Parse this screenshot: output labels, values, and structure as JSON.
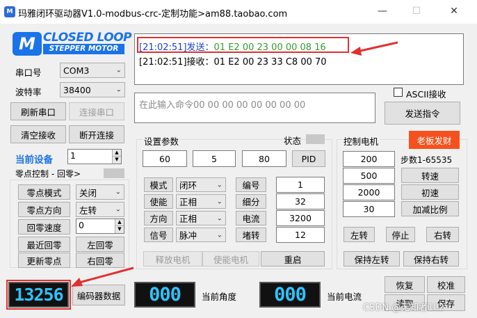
{
  "window": {
    "title": "玛雅闭环驱动器V1.0-modbus-crc-定制功能>am88.taobao.com",
    "icon_name": "app-logo-icon",
    "minimize": "—",
    "maximize": "☐",
    "close": "✕"
  },
  "logo": {
    "line1": "CLOSED LOOP",
    "line2": "STEPPER MOTOR",
    "mark": "M",
    "accent": "#1a73e8"
  },
  "serial": {
    "port_label": "串口号",
    "port_value": "COM3",
    "baud_label": "波特率",
    "baud_value": "38400",
    "refresh_btn": "刷新串口",
    "connect_btn": "连接串口",
    "clear_btn": "清空接收",
    "disconnect_btn": "断开连接"
  },
  "rx": {
    "line1_time": "[21:02:51]",
    "line1_kind": "发送：",
    "line1_data": "01 E2 00 23 00 00 08 16",
    "line2": "[21:02:51]接收：01 E2 00 23 33 C8 00 70",
    "ascii_label": "ASCII接收",
    "send_color": "#2e9e2e",
    "highlight_color": "#e03131"
  },
  "cmd": {
    "placeholder": "在此输入命令00 00 00 00 00 00 00 00",
    "send_btn": "发送指令"
  },
  "device": {
    "current_label": "当前设备",
    "current_value": "1",
    "zero_label": "零点控制 - 回零>",
    "zero_mode_btn": "零点模式",
    "zero_mode_value": "关闭",
    "zero_dir_btn": "零点方向",
    "zero_dir_value": "左转",
    "zero_speed_btn": "回零速度",
    "zero_speed_value": "0",
    "nearest_btn": "最近回零",
    "left_home_btn": "左回零",
    "update_btn": "更新零点",
    "right_home_btn": "右回零"
  },
  "params": {
    "title": "设置参数",
    "status_label": "状态",
    "p1": "60",
    "p2": "5",
    "p3": "80",
    "pid_btn": "PID",
    "mode_label": "模式",
    "mode_value": "闭环",
    "enable_label": "使能",
    "enable_value": "正相",
    "dir_label": "方向",
    "dir_value": "正相",
    "signal_label": "信号",
    "signal_value": "脉冲",
    "id_label": "编号",
    "id_value": "1",
    "subdiv_label": "细分",
    "subdiv_value": "32",
    "current_label": "电流",
    "current_value": "3200",
    "stall_label": "堵转",
    "stall_value": "12",
    "release_btn": "释放电机",
    "enable_btn": "使能电机",
    "restart_btn": "重启"
  },
  "motor": {
    "title": "控制电机",
    "tag": "老板发财",
    "tag_color": "#f5511e",
    "step_label": "步数1-65535",
    "v1": "200",
    "v2": "500",
    "v3": "2000",
    "v4": "30",
    "speed_btn": "转速",
    "init_speed_btn": "初速",
    "accel_btn": "加减比例",
    "left_btn": "左转",
    "stop_btn": "停止",
    "right_btn": "右转",
    "hold_left_btn": "保持左转",
    "hold_right_btn": "保持右转"
  },
  "readouts": {
    "encoder_value": "13256",
    "encoder_btn": "编码器数据",
    "angle_value": "000",
    "angle_label": "当前角度",
    "current_value": "000",
    "current_label": "当前电流",
    "digit_color": "#2fc3ff"
  },
  "bottom_right": {
    "restore_btn": "恢复",
    "calib_btn": "校准",
    "read_btn": "读取",
    "save_btn": "保存"
  },
  "watermark": "CSDN @无知者1L2"
}
